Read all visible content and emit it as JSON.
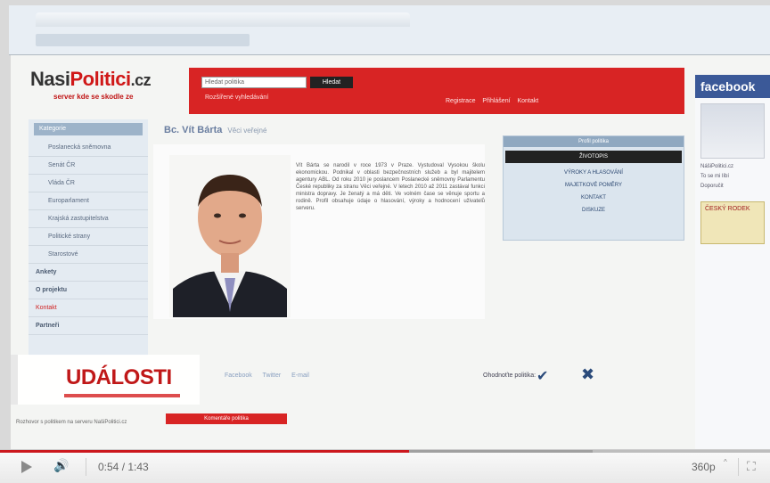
{
  "site": {
    "logo_left": "Nasi",
    "logo_red": "Politici",
    "logo_tld": ".cz",
    "tagline": "server kde se skodle ze"
  },
  "search": {
    "placeholder": "Hledat politika",
    "button": "Hledat",
    "advanced": "Rozšířené vyhledávání"
  },
  "top_nav": "Registrace  Přihlášení  Kontakt",
  "sidebar": {
    "header": "Kategorie",
    "items": [
      {
        "label": "Poslanecká sněmovna",
        "type": "normal"
      },
      {
        "label": "Senát ČR",
        "type": "normal"
      },
      {
        "label": "Vláda ČR",
        "type": "normal"
      },
      {
        "label": "Europarlament",
        "type": "normal"
      },
      {
        "label": "Krajská zastupitelstva",
        "type": "normal"
      },
      {
        "label": "Politické strany",
        "type": "normal"
      },
      {
        "label": "Starostové",
        "type": "normal"
      },
      {
        "label": "Ankety",
        "type": "sub"
      },
      {
        "label": "O projektu",
        "type": "sub"
      },
      {
        "label": "Kontakt",
        "type": "red"
      },
      {
        "label": "Partneři",
        "type": "sub"
      }
    ]
  },
  "profile": {
    "name": "Bc. Vít Bárta",
    "party": "Věci veřejné",
    "bio": "Vít Bárta se narodil v roce 1973 v Praze. Vystudoval Vysokou školu ekonomickou. Podnikal v oblasti bezpečnostních služeb a byl majitelem agentury ABL. Od roku 2010 je poslancem Poslanecké sněmovny Parlamentu České republiky za stranu Věci veřejné. V letech 2010 až 2011 zastával funkci ministra dopravy. Je ženatý a má děti. Ve volném čase se věnuje sportu a rodině. Profil obsahuje údaje o hlasování, výroky a hodnocení uživatelů serveru."
  },
  "profile_menu": {
    "header": "Profil politika",
    "items": [
      {
        "label": "ŽIVOTOPIS",
        "active": true
      },
      {
        "label": "VÝROKY A HLASOVÁNÍ",
        "active": false
      },
      {
        "label": "MAJETKOVÉ POMĚRY",
        "active": false
      },
      {
        "label": "KONTAKT",
        "active": false
      },
      {
        "label": "DISKUZE",
        "active": false
      }
    ]
  },
  "facebook": {
    "header": "facebook",
    "lines": [
      "NášiPolitici.cz",
      "To se mi líbí",
      "Doporučit"
    ],
    "badge": "ČESKÝ RODEK"
  },
  "share": {
    "links": "Facebook  Twitter  E-mail",
    "rate_label": "Ohodnoťte politika:",
    "yes": "✔",
    "no": "✖"
  },
  "red_strip": "Komentáře politika",
  "caption": "Rozhovor s politikem na serveru NašiPolitici.cz",
  "overlay": {
    "brand": "UDÁLOSTI"
  },
  "player": {
    "progress_fraction": 0.531,
    "buffer_fraction": 0.77,
    "time": "0:54 / 1:43",
    "quality": "360p",
    "quality_arrow": "^",
    "progress_color": "#cc181e"
  }
}
